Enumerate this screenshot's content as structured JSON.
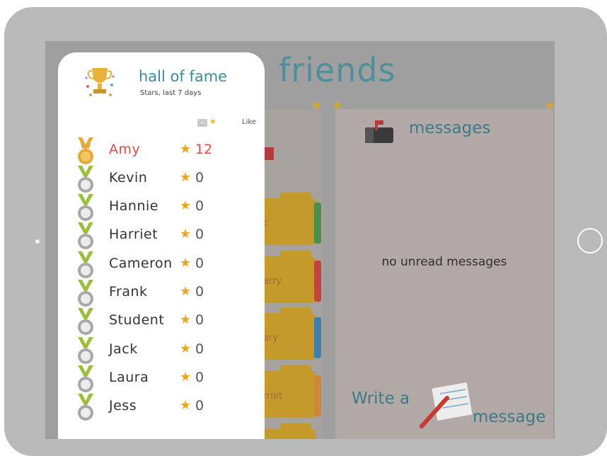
{
  "screen": {
    "background_title": "friends",
    "messages": {
      "title": "messages",
      "empty_text": "no unread messages",
      "write_prefix": "Write a",
      "write_suffix": "message"
    },
    "folder_labels": [
      "c",
      "arry",
      "ary",
      "rriet",
      ""
    ]
  },
  "hall_of_fame": {
    "title": "hall of fame",
    "subtitle": "Stars, last 7 days",
    "columns": {
      "like_label": "Like"
    },
    "entries": [
      {
        "name": "Amy",
        "stars": "12",
        "medal": "gold"
      },
      {
        "name": "Kevin",
        "stars": "0",
        "medal": "silver"
      },
      {
        "name": "Hannie",
        "stars": "0",
        "medal": "silver"
      },
      {
        "name": "Harriet",
        "stars": "0",
        "medal": "silver"
      },
      {
        "name": "Cameron",
        "stars": "0",
        "medal": "silver"
      },
      {
        "name": "Frank",
        "stars": "0",
        "medal": "silver"
      },
      {
        "name": "Student",
        "stars": "0",
        "medal": "silver"
      },
      {
        "name": "Jack",
        "stars": "0",
        "medal": "silver"
      },
      {
        "name": "Laura",
        "stars": "0",
        "medal": "silver"
      },
      {
        "name": "Jess",
        "stars": "0",
        "medal": "silver"
      }
    ]
  },
  "colors": {
    "accent_teal": "#3f8b99",
    "leader_red": "#d94b46",
    "star_gold": "#e9a628",
    "medal_gold": "#e5a83a",
    "medal_silver": "#a8a8a8",
    "ribbon_green": "#9cbf3a"
  },
  "icons": [
    "trophy-icon",
    "gold-medal-icon",
    "silver-medal-icon",
    "star-icon",
    "mailbox-icon",
    "pencil-note-icon",
    "graph-icon",
    "home-button"
  ]
}
